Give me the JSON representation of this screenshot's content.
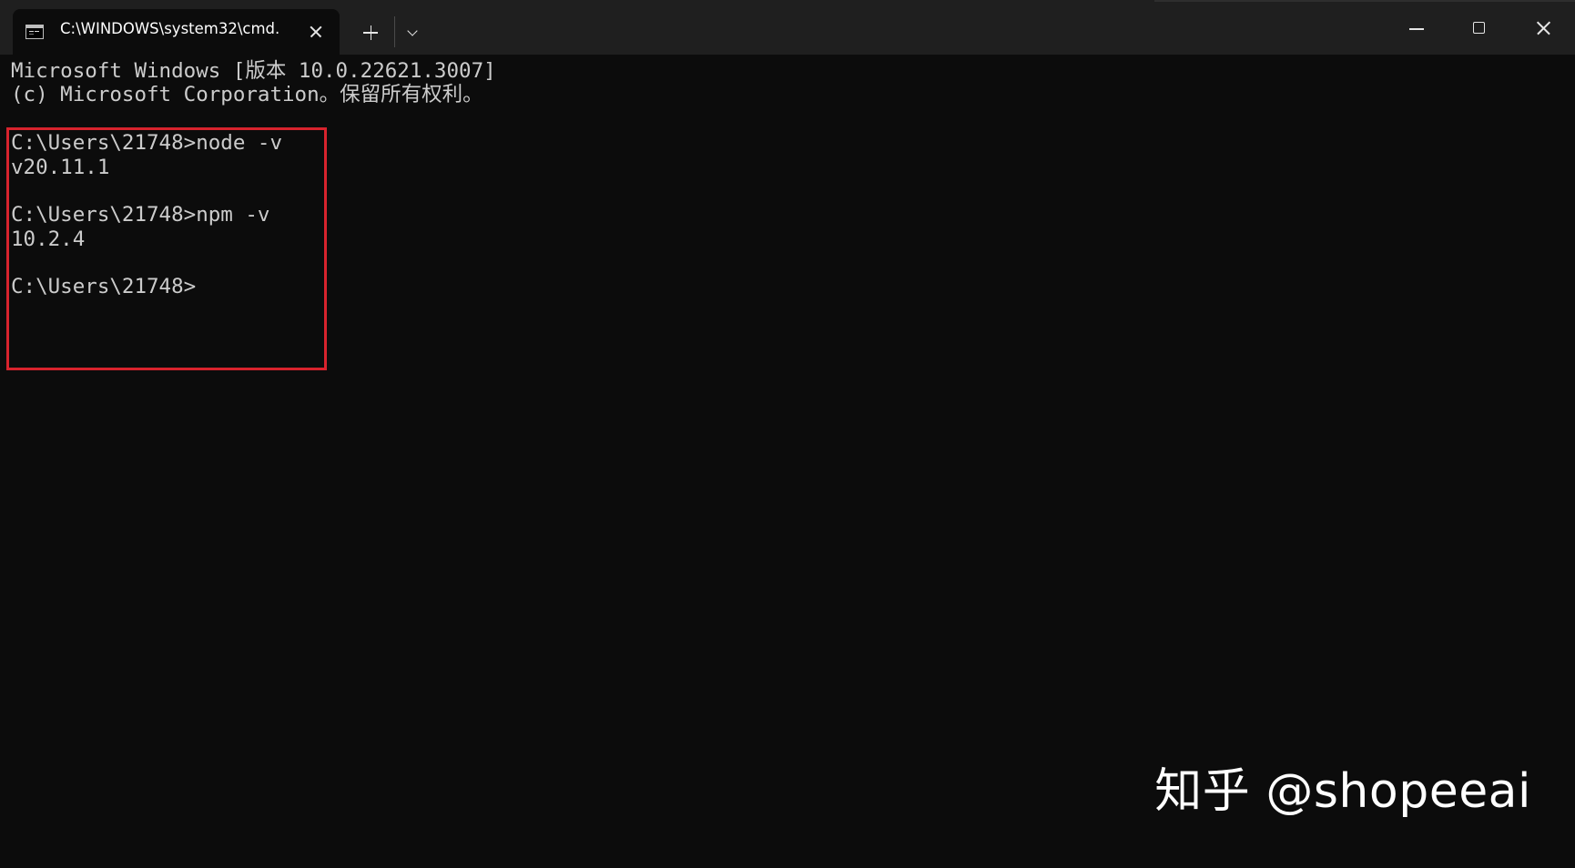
{
  "tab": {
    "title": "C:\\WINDOWS\\system32\\cmd.",
    "icon": "cmd-terminal-icon"
  },
  "tabbar": {
    "new_tab_icon": "plus-icon",
    "dropdown_icon": "chevron-down-icon"
  },
  "window_controls": {
    "minimize_icon": "minimize-icon",
    "maximize_icon": "maximize-icon",
    "close_icon": "close-icon"
  },
  "console": {
    "lines": [
      "Microsoft Windows [版本 10.0.22621.3007]",
      "(c) Microsoft Corporation。保留所有权利。",
      "",
      "C:\\Users\\21748>node -v",
      "v20.11.1",
      "",
      "C:\\Users\\21748>npm -v",
      "10.2.4",
      "",
      "C:\\Users\\21748>"
    ],
    "highlight_color": "#d8232d"
  },
  "watermark": {
    "text": "知乎 @shopeeai"
  },
  "colors": {
    "background": "#0c0c0c",
    "titlebar": "#1f1f1f",
    "text": "#cccccc"
  }
}
